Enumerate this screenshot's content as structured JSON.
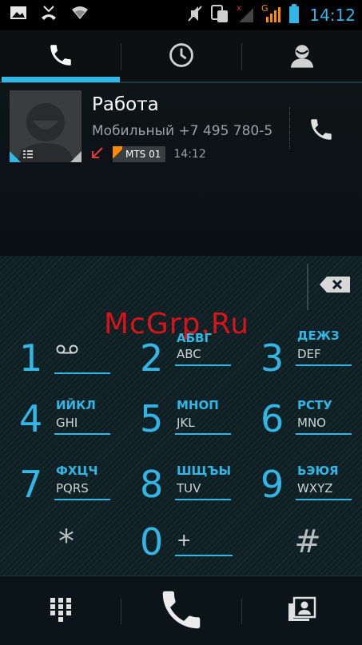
{
  "status_bar": {
    "time": "14:12",
    "signal_label": "G",
    "icons": [
      "image-icon",
      "missed-call-icon",
      "wifi-icon",
      "mute-icon",
      "sim-manager-icon",
      "signal-1-icon",
      "signal-2-icon",
      "battery-icon"
    ]
  },
  "tabs": [
    {
      "name": "phone-tab",
      "icon": "phone-icon",
      "active": true
    },
    {
      "name": "recents-tab",
      "icon": "clock-icon",
      "active": false
    },
    {
      "name": "contacts-tab",
      "icon": "person-icon",
      "active": false
    }
  ],
  "contact": {
    "name": "Работа",
    "number": "Мобильный +7 495 780-5",
    "sim_label": "MTS 01",
    "time": "14:12",
    "call_direction_icon": "outgoing-call-arrow-icon"
  },
  "colors": {
    "accent": "#33b5e5",
    "sim_flag": "#ff8a00",
    "watermark": "#d8141a"
  },
  "watermark": "McGrp.Ru",
  "keys": [
    {
      "num": "1",
      "cyr": "",
      "lat": "",
      "voicemail": true
    },
    {
      "num": "2",
      "cyr": "АБВГ",
      "lat": "ABC"
    },
    {
      "num": "3",
      "cyr": "ДЕЖЗ",
      "lat": "DEF"
    },
    {
      "num": "4",
      "cyr": "ИЙКЛ",
      "lat": "GHI"
    },
    {
      "num": "5",
      "cyr": "МНОП",
      "lat": "JKL"
    },
    {
      "num": "6",
      "cyr": "РСТУ",
      "lat": "MNO"
    },
    {
      "num": "7",
      "cyr": "ФХЦЧ",
      "lat": "PQRS"
    },
    {
      "num": "8",
      "cyr": "ШЩЪЫ",
      "lat": "TUV"
    },
    {
      "num": "9",
      "cyr": "ЬЭЮЯ",
      "lat": "WXYZ"
    },
    {
      "sym": "*"
    },
    {
      "num": "0",
      "lat": "+"
    },
    {
      "sym": "#"
    }
  ],
  "action_bar": {
    "buttons": [
      "dialpad-toggle-button",
      "call-button",
      "add-contact-button"
    ]
  }
}
